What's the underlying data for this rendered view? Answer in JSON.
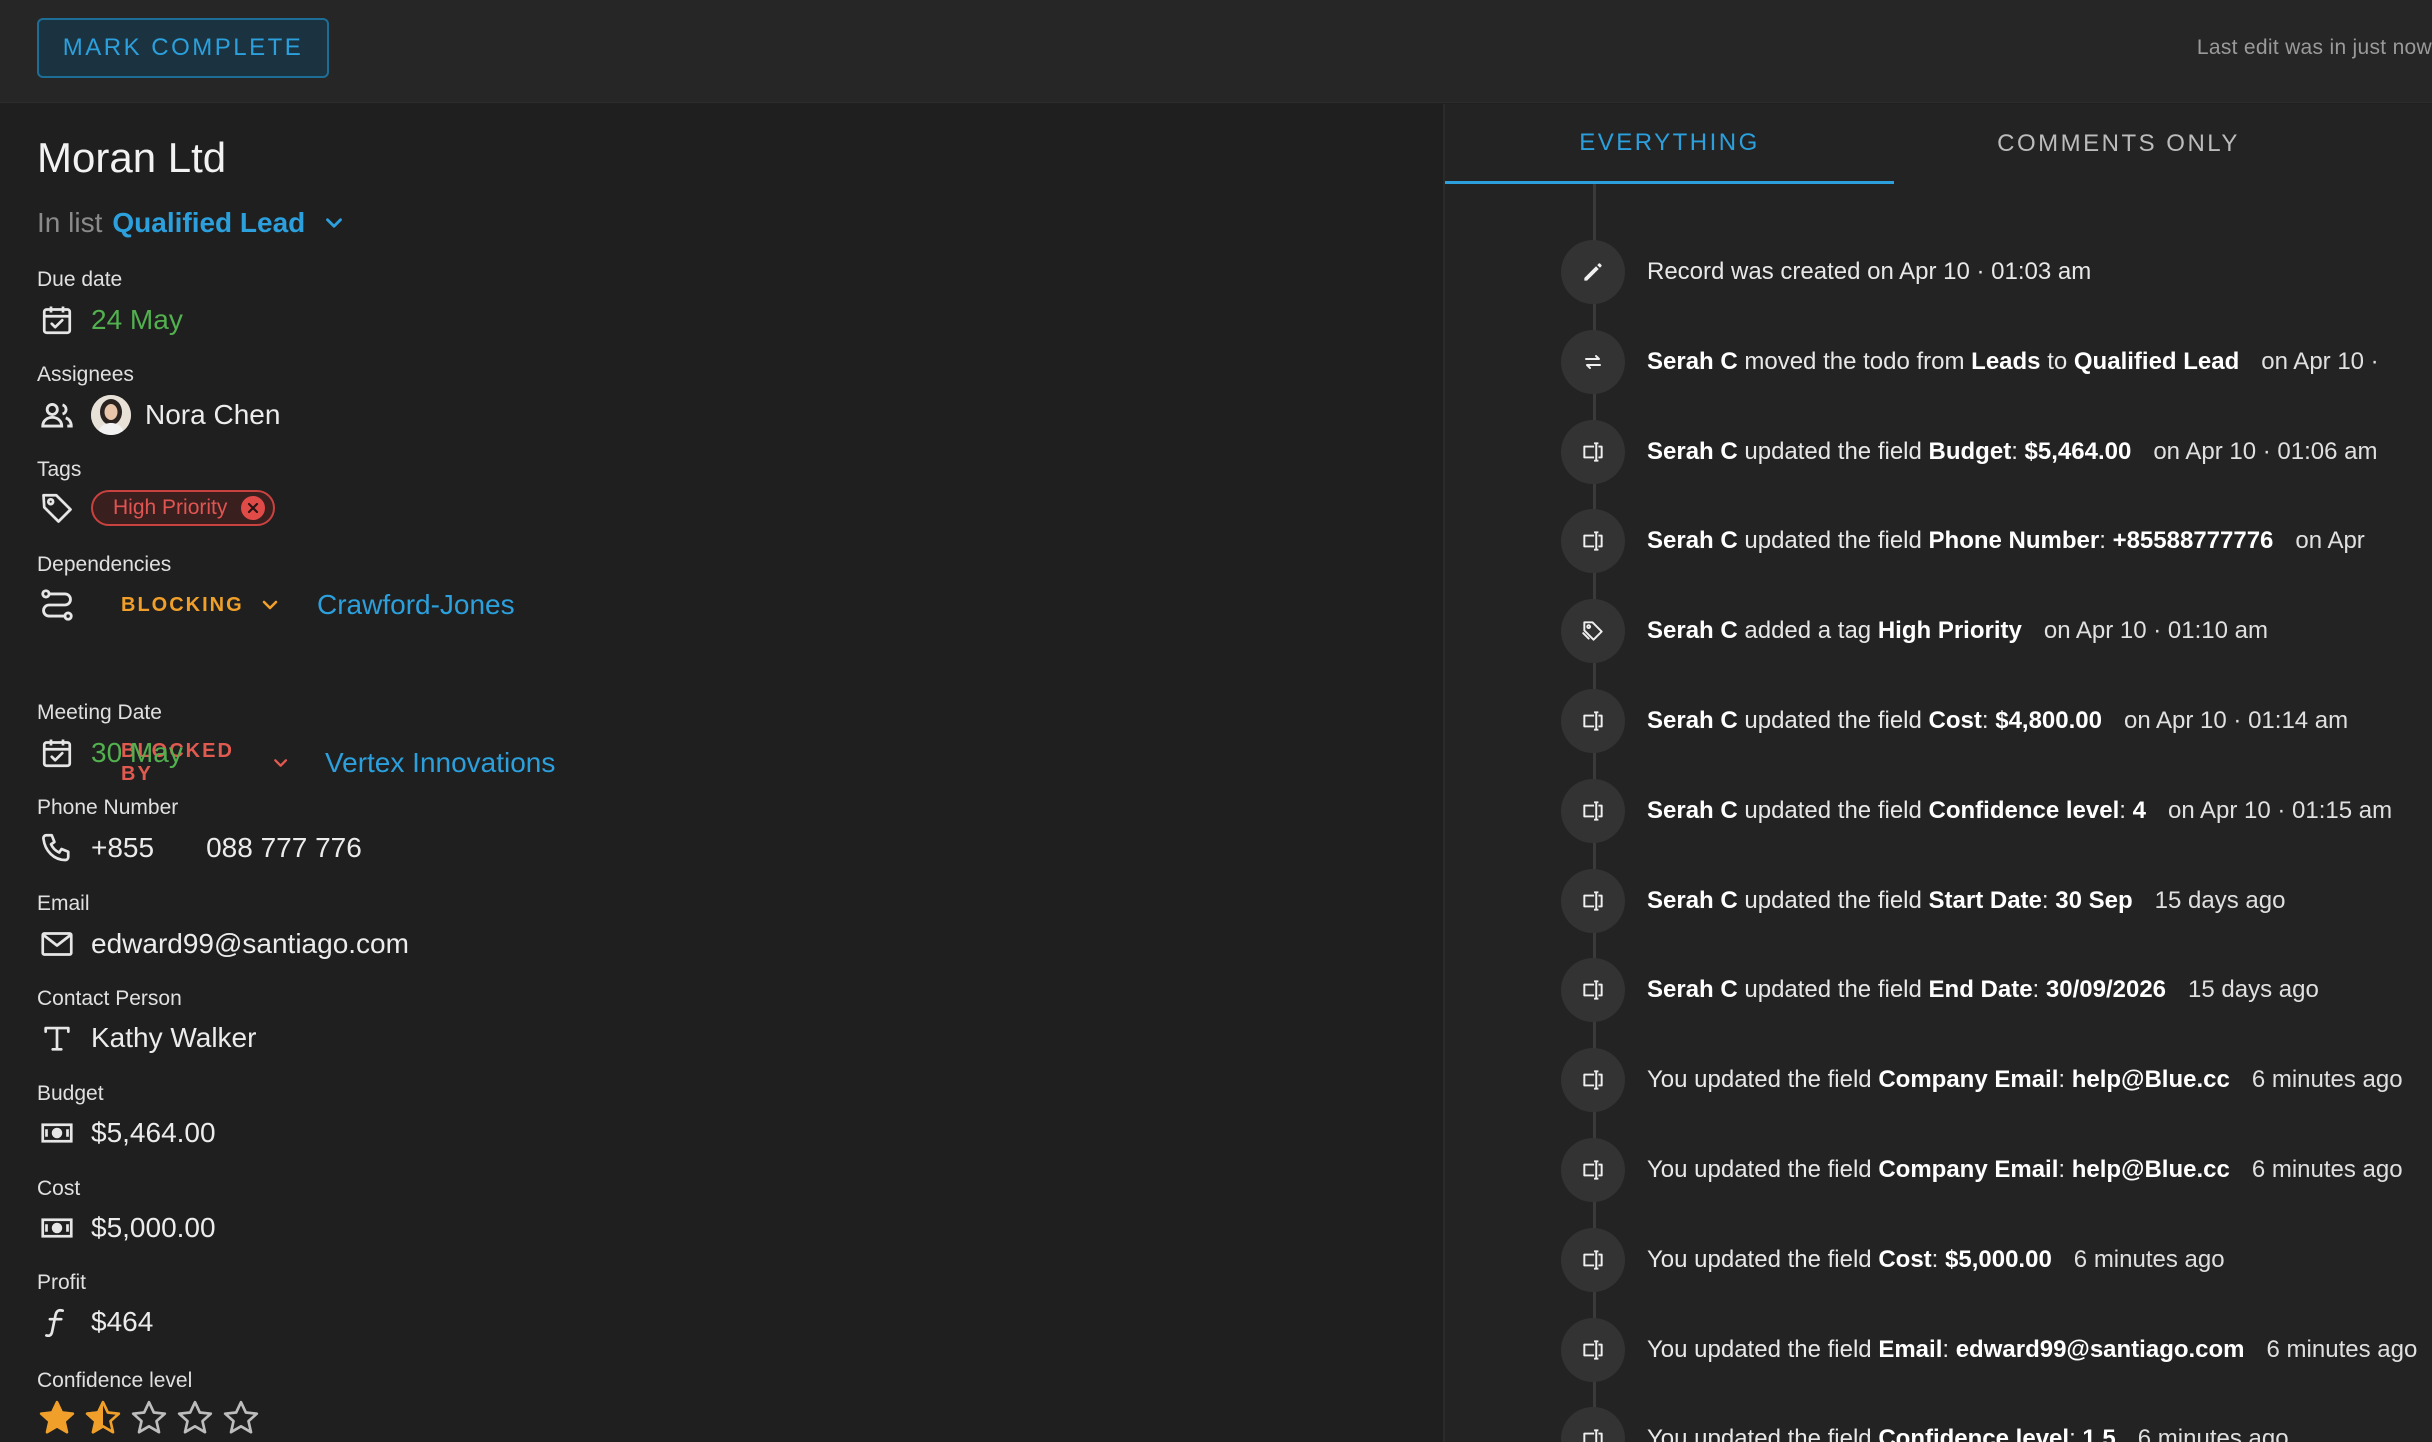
{
  "topbar": {
    "mark_complete": "MARK COMPLETE",
    "last_edit": "Last edit was in just now"
  },
  "record": {
    "title": "Moran Ltd",
    "in_list_prefix": "In list",
    "list_name": "Qualified Lead"
  },
  "fields": {
    "due_date": {
      "label": "Due date",
      "value": "24 May"
    },
    "assignees": {
      "label": "Assignees",
      "value": "Nora Chen"
    },
    "tags": {
      "label": "Tags",
      "items": [
        "High Priority"
      ]
    },
    "dependencies": {
      "label": "Dependencies",
      "blocking_label": "BLOCKING",
      "blocking_value": "Crawford-Jones",
      "blocked_by_label": "BLOCKED BY",
      "blocked_by_value": "Vertex Innovations"
    },
    "meeting_date": {
      "label": "Meeting Date",
      "value": "30 May"
    },
    "phone": {
      "label": "Phone Number",
      "country_code": "+855",
      "number": "088 777 776"
    },
    "email": {
      "label": "Email",
      "value": "edward99@santiago.com"
    },
    "contact_person": {
      "label": "Contact Person",
      "value": "Kathy Walker"
    },
    "budget": {
      "label": "Budget",
      "value": "$5,464.00"
    },
    "cost": {
      "label": "Cost",
      "value": "$5,000.00"
    },
    "profit": {
      "label": "Profit",
      "value": "$464"
    },
    "confidence": {
      "label": "Confidence level",
      "rating": 1.5,
      "max": 5
    }
  },
  "activity": {
    "tabs": [
      "EVERYTHING",
      "COMMENTS ONLY"
    ],
    "items": [
      {
        "icon": "pencil-icon",
        "parts": [
          [
            "t",
            "Record was created on Apr 10 · 01:03 am"
          ]
        ],
        "when": ""
      },
      {
        "icon": "swap-icon",
        "parts": [
          [
            "b",
            "Serah C"
          ],
          [
            "t",
            " moved the todo from "
          ],
          [
            "b",
            "Leads"
          ],
          [
            "t",
            " to "
          ],
          [
            "b",
            "Qualified Lead"
          ]
        ],
        "when": "on Apr 10 ·"
      },
      {
        "icon": "field-icon",
        "parts": [
          [
            "b",
            "Serah C"
          ],
          [
            "t",
            " updated the field "
          ],
          [
            "b",
            "Budget"
          ],
          [
            "t",
            ": "
          ],
          [
            "b",
            "$5,464.00"
          ]
        ],
        "when": "on Apr 10 · 01:06 am"
      },
      {
        "icon": "field-icon",
        "parts": [
          [
            "b",
            "Serah C"
          ],
          [
            "t",
            " updated the field "
          ],
          [
            "b",
            "Phone Number"
          ],
          [
            "t",
            ": "
          ],
          [
            "b",
            "+85588777776"
          ]
        ],
        "when": "on Apr"
      },
      {
        "icon": "tag-icon",
        "parts": [
          [
            "b",
            "Serah C"
          ],
          [
            "t",
            " added a tag "
          ],
          [
            "b",
            "High Priority"
          ]
        ],
        "when": "on Apr 10 · 01:10 am"
      },
      {
        "icon": "field-icon",
        "parts": [
          [
            "b",
            "Serah C"
          ],
          [
            "t",
            " updated the field "
          ],
          [
            "b",
            "Cost"
          ],
          [
            "t",
            ": "
          ],
          [
            "b",
            "$4,800.00"
          ]
        ],
        "when": "on Apr 10 · 01:14 am"
      },
      {
        "icon": "field-icon",
        "parts": [
          [
            "b",
            "Serah C"
          ],
          [
            "t",
            " updated the field "
          ],
          [
            "b",
            "Confidence level"
          ],
          [
            "t",
            ": "
          ],
          [
            "b",
            "4"
          ]
        ],
        "when": "on Apr 10 · 01:15 am"
      },
      {
        "icon": "field-icon",
        "parts": [
          [
            "b",
            "Serah C"
          ],
          [
            "t",
            " updated the field "
          ],
          [
            "b",
            "Start Date"
          ],
          [
            "t",
            ": "
          ],
          [
            "b",
            "30 Sep"
          ]
        ],
        "when": "15 days ago"
      },
      {
        "icon": "field-icon",
        "parts": [
          [
            "b",
            "Serah C"
          ],
          [
            "t",
            " updated the field "
          ],
          [
            "b",
            "End Date"
          ],
          [
            "t",
            ": "
          ],
          [
            "b",
            "30/09/2026"
          ]
        ],
        "when": "15 days ago"
      },
      {
        "icon": "field-icon",
        "parts": [
          [
            "t",
            "You updated the field "
          ],
          [
            "b",
            "Company Email"
          ],
          [
            "t",
            ": "
          ],
          [
            "b",
            "help@Blue.cc"
          ]
        ],
        "when": "6 minutes ago"
      },
      {
        "icon": "field-icon",
        "parts": [
          [
            "t",
            "You updated the field "
          ],
          [
            "b",
            "Company Email"
          ],
          [
            "t",
            ": "
          ],
          [
            "b",
            "help@Blue.cc"
          ]
        ],
        "when": "6 minutes ago"
      },
      {
        "icon": "field-icon",
        "parts": [
          [
            "t",
            "You updated the field "
          ],
          [
            "b",
            "Cost"
          ],
          [
            "t",
            ": "
          ],
          [
            "b",
            "$5,000.00"
          ]
        ],
        "when": "6 minutes ago"
      },
      {
        "icon": "field-icon",
        "parts": [
          [
            "t",
            "You updated the field "
          ],
          [
            "b",
            "Email"
          ],
          [
            "t",
            ": "
          ],
          [
            "b",
            "edward99@santiago.com"
          ]
        ],
        "when": "6 minutes ago"
      },
      {
        "icon": "field-icon",
        "parts": [
          [
            "t",
            "You updated the field "
          ],
          [
            "b",
            "Confidence level"
          ],
          [
            "t",
            ": "
          ],
          [
            "b",
            "1.5"
          ]
        ],
        "when": "6 minutes ago"
      }
    ]
  },
  "colors": {
    "accent": "#2ba0dd",
    "date_green": "#52b04f",
    "blocking": "#f0a02a",
    "blocked_by": "#e05a50",
    "tag_red": "#e05552"
  }
}
